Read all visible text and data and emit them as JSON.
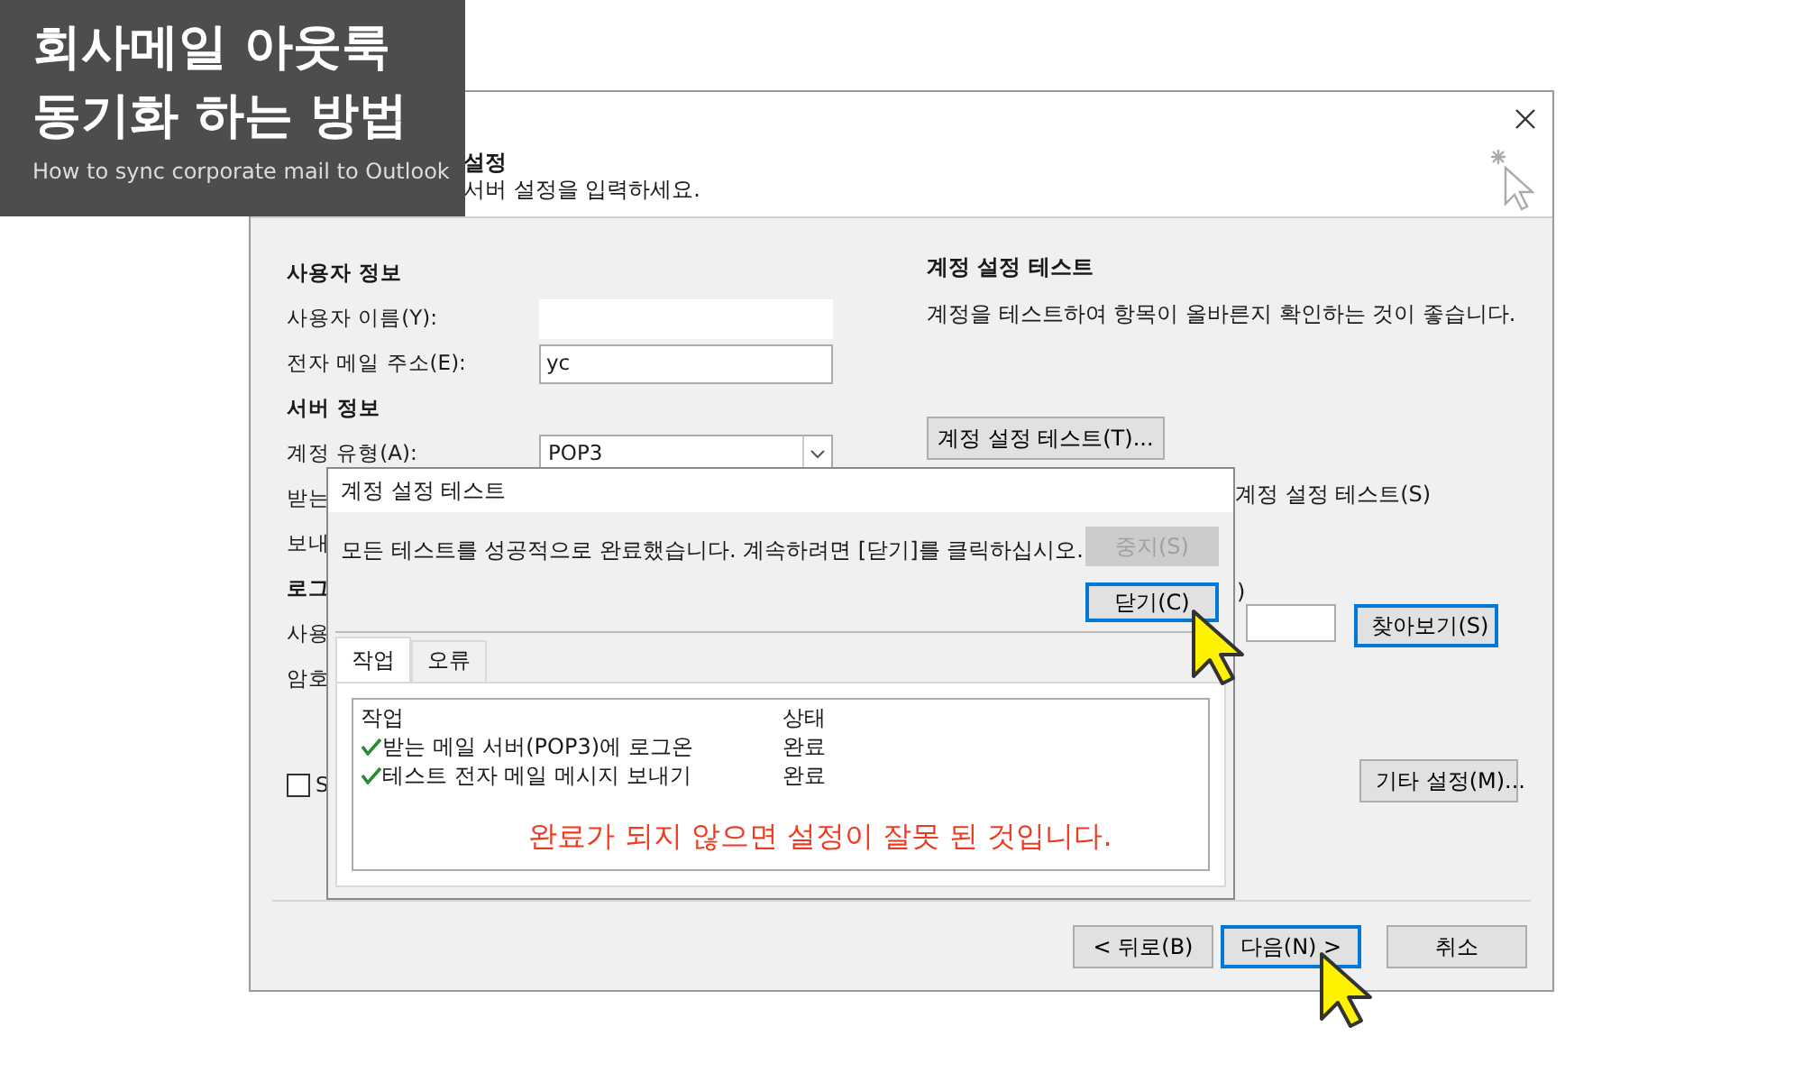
{
  "banner": {
    "title_lines": [
      "회사메일 아웃룩",
      "동기화 하는 방법"
    ],
    "subtitle": "How to sync corporate mail to Outlook"
  },
  "window": {
    "header": {
      "title": "설정",
      "subtitle": "서버 설정을 입력하세요."
    },
    "form": [
      {
        "kind": "heading",
        "label": "사용자 정보"
      },
      {
        "kind": "field",
        "label": "사용자 이름(Y):",
        "bordered": false
      },
      {
        "kind": "field",
        "label": "전자 메일 주소(E):",
        "value": "yc",
        "bordered": true
      },
      {
        "kind": "heading",
        "label": "서버 정보"
      },
      {
        "kind": "select",
        "label": "계정 유형(A):",
        "value": "POP3"
      },
      {
        "kind": "label",
        "label": "받는"
      },
      {
        "kind": "label",
        "label": "보내"
      },
      {
        "kind": "heading",
        "label": "로그"
      },
      {
        "kind": "label",
        "label": "사용"
      },
      {
        "kind": "label",
        "label": "암호"
      },
      {
        "kind": "checkbox",
        "label": "S",
        "checked": false
      }
    ],
    "test": {
      "title": "계정 설정 테스트",
      "description": "계정을 테스트하여 항목이 올바른지 확인하는 것이 좋습니다.",
      "button": "계정 설정 테스트(T)...",
      "auto_test_label": "계정 설정 테스트(S)"
    },
    "paren": ")",
    "browse_button": "찾아보기(S)",
    "more_button": "기타 설정(M)...",
    "footer_buttons": [
      {
        "label": "< 뒤로(B)",
        "default": false
      },
      {
        "label": "다음(N) >",
        "default": true
      },
      {
        "label": "취소",
        "default": false
      }
    ]
  },
  "test_dialog": {
    "title": "계정 설정 테스트",
    "message": "모든 테스트를 성공적으로 완료했습니다. 계속하려면 [닫기]를 클릭하십시오.",
    "buttons": [
      {
        "label": "중지(S)",
        "disabled": true,
        "default": false
      },
      {
        "label": "닫기(C)",
        "disabled": false,
        "default": true
      }
    ],
    "tabs": [
      {
        "label": "작업",
        "selected": true
      },
      {
        "label": "오류",
        "selected": false
      }
    ],
    "columns": [
      "작업",
      "상태"
    ],
    "rows": [
      {
        "task": "받는 메일 서버(POP3)에 로그온",
        "status": "완료",
        "done": true
      },
      {
        "task": "테스트 전자 메일 메시지 보내기",
        "status": "완료",
        "done": true
      }
    ],
    "note": "완료가 되지 않으면 설정이 잘못 된 것입니다."
  }
}
